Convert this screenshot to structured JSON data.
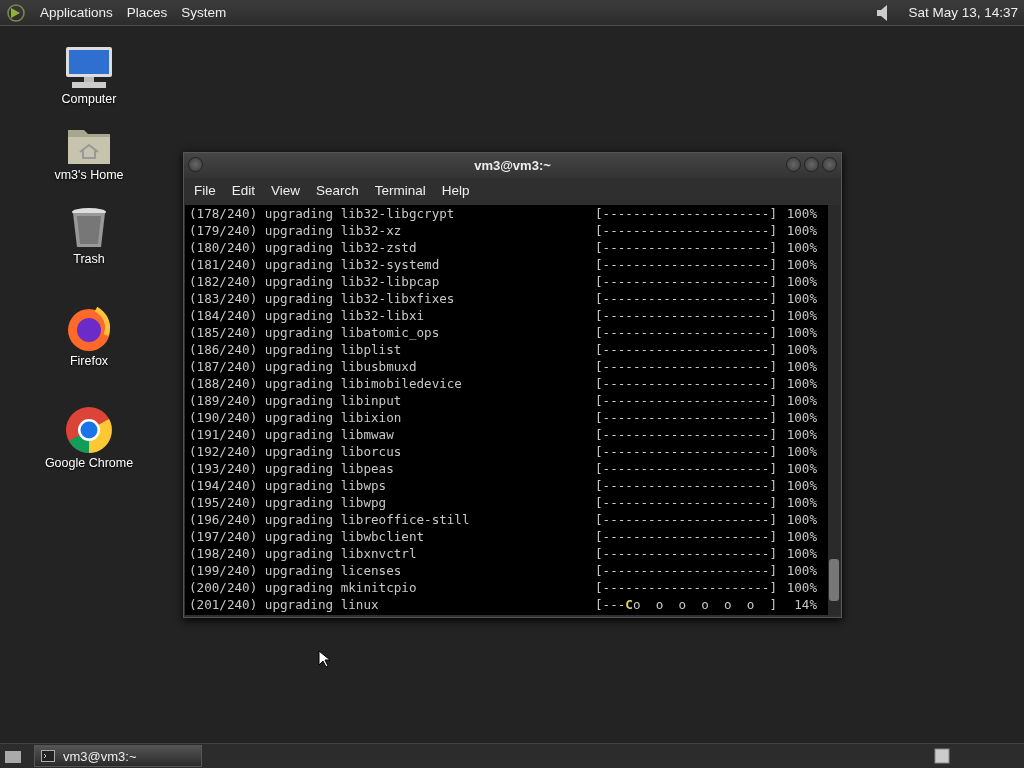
{
  "top_panel": {
    "menus": [
      "Applications",
      "Places",
      "System"
    ],
    "clock": "Sat May 13, 14:37"
  },
  "desktop_icons": [
    {
      "kind": "computer",
      "label": "Computer"
    },
    {
      "kind": "home",
      "label": "vm3's Home"
    },
    {
      "kind": "trash",
      "label": "Trash"
    },
    {
      "kind": "firefox",
      "label": "Firefox"
    },
    {
      "kind": "chrome",
      "label": "Google Chrome"
    }
  ],
  "terminal": {
    "title": "vm3@vm3:~",
    "menu": [
      "File",
      "Edit",
      "View",
      "Search",
      "Terminal",
      "Help"
    ],
    "lines": [
      {
        "kind": "done",
        "text": "(178/240) upgrading lib32-libgcrypt",
        "bar": "[----------------------]",
        "percent": "100%"
      },
      {
        "kind": "done",
        "text": "(179/240) upgrading lib32-xz",
        "bar": "[----------------------]",
        "percent": "100%"
      },
      {
        "kind": "done",
        "text": "(180/240) upgrading lib32-zstd",
        "bar": "[----------------------]",
        "percent": "100%"
      },
      {
        "kind": "done",
        "text": "(181/240) upgrading lib32-systemd",
        "bar": "[----------------------]",
        "percent": "100%"
      },
      {
        "kind": "done",
        "text": "(182/240) upgrading lib32-libpcap",
        "bar": "[----------------------]",
        "percent": "100%"
      },
      {
        "kind": "done",
        "text": "(183/240) upgrading lib32-libxfixes",
        "bar": "[----------------------]",
        "percent": "100%"
      },
      {
        "kind": "done",
        "text": "(184/240) upgrading lib32-libxi",
        "bar": "[----------------------]",
        "percent": "100%"
      },
      {
        "kind": "done",
        "text": "(185/240) upgrading libatomic_ops",
        "bar": "[----------------------]",
        "percent": "100%"
      },
      {
        "kind": "done",
        "text": "(186/240) upgrading libplist",
        "bar": "[----------------------]",
        "percent": "100%"
      },
      {
        "kind": "done",
        "text": "(187/240) upgrading libusbmuxd",
        "bar": "[----------------------]",
        "percent": "100%"
      },
      {
        "kind": "done",
        "text": "(188/240) upgrading libimobiledevice",
        "bar": "[----------------------]",
        "percent": "100%"
      },
      {
        "kind": "done",
        "text": "(189/240) upgrading libinput",
        "bar": "[----------------------]",
        "percent": "100%"
      },
      {
        "kind": "done",
        "text": "(190/240) upgrading libixion",
        "bar": "[----------------------]",
        "percent": "100%"
      },
      {
        "kind": "done",
        "text": "(191/240) upgrading libmwaw",
        "bar": "[----------------------]",
        "percent": "100%"
      },
      {
        "kind": "done",
        "text": "(192/240) upgrading liborcus",
        "bar": "[----------------------]",
        "percent": "100%"
      },
      {
        "kind": "done",
        "text": "(193/240) upgrading libpeas",
        "bar": "[----------------------]",
        "percent": "100%"
      },
      {
        "kind": "done",
        "text": "(194/240) upgrading libwps",
        "bar": "[----------------------]",
        "percent": "100%"
      },
      {
        "kind": "done",
        "text": "(195/240) upgrading libwpg",
        "bar": "[----------------------]",
        "percent": "100%"
      },
      {
        "kind": "done",
        "text": "(196/240) upgrading libreoffice-still",
        "bar": "[----------------------]",
        "percent": "100%"
      },
      {
        "kind": "done",
        "text": "(197/240) upgrading libwbclient",
        "bar": "[----------------------]",
        "percent": "100%"
      },
      {
        "kind": "done",
        "text": "(198/240) upgrading libxnvctrl",
        "bar": "[----------------------]",
        "percent": "100%"
      },
      {
        "kind": "done",
        "text": "(199/240) upgrading licenses",
        "bar": "[----------------------]",
        "percent": "100%"
      },
      {
        "kind": "done",
        "text": "(200/240) upgrading mkinitcpio",
        "bar": "[----------------------]",
        "percent": "100%"
      },
      {
        "kind": "active",
        "text": "(201/240) upgrading linux",
        "bar_head": "[---",
        "cursor": "C",
        "bar_tail": "o  o  o  o  o  o  ]",
        "percent": "14%"
      }
    ]
  },
  "taskbar": {
    "tasks": [
      {
        "label": "vm3@vm3:~",
        "selected": true
      }
    ]
  }
}
